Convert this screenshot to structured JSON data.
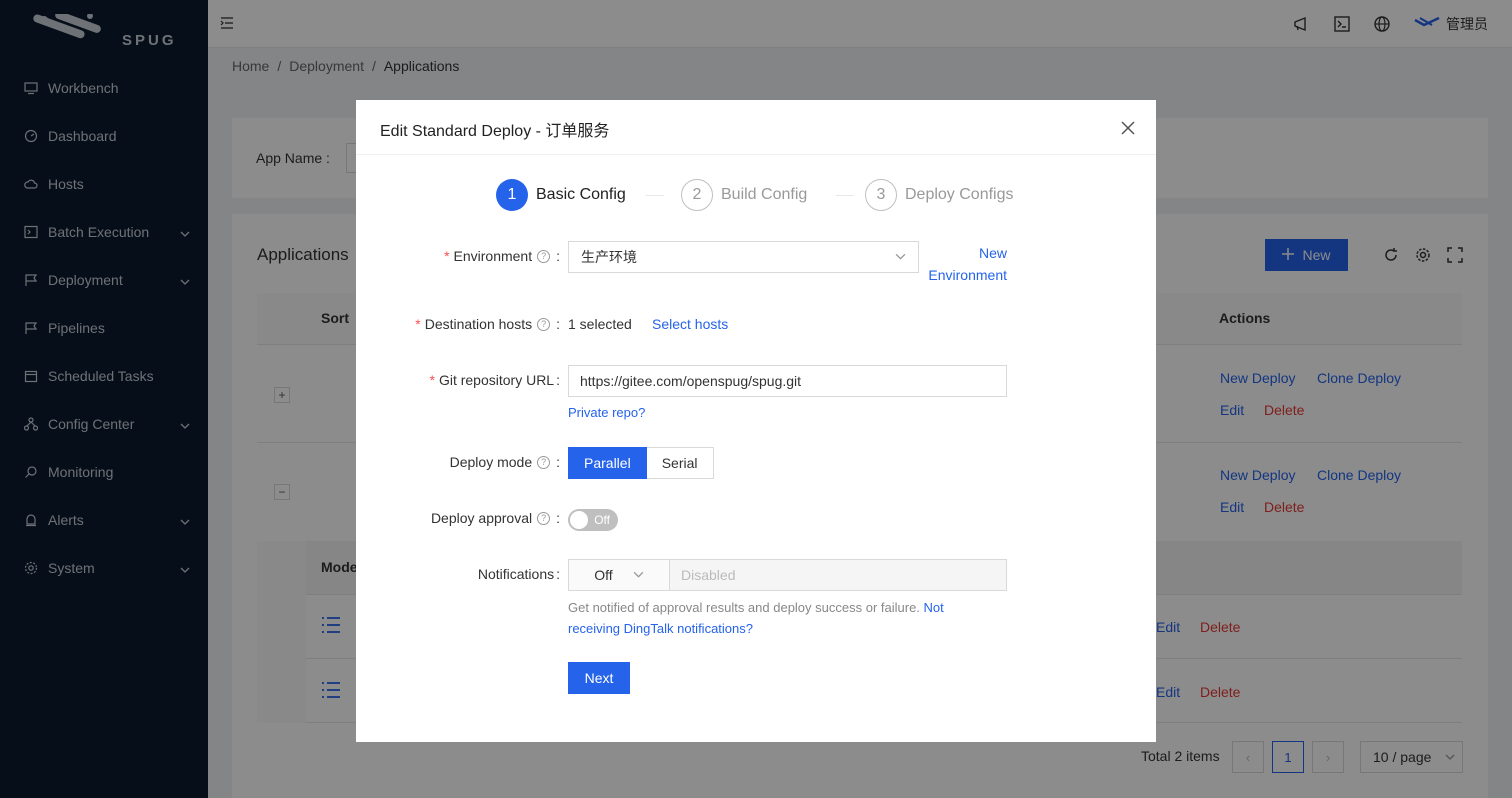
{
  "brand": {
    "name": "SPUG"
  },
  "sidebar": {
    "items": [
      {
        "label": "Workbench",
        "icon": "monitor-icon",
        "has_children": false
      },
      {
        "label": "Dashboard",
        "icon": "gauge-icon",
        "has_children": false
      },
      {
        "label": "Hosts",
        "icon": "cloud-icon",
        "has_children": false
      },
      {
        "label": "Batch Execution",
        "icon": "terminal-icon",
        "has_children": true
      },
      {
        "label": "Deployment",
        "icon": "flag-icon",
        "has_children": true
      },
      {
        "label": "Pipelines",
        "icon": "flag-icon",
        "has_children": false
      },
      {
        "label": "Scheduled Tasks",
        "icon": "calendar-icon",
        "has_children": false
      },
      {
        "label": "Config Center",
        "icon": "cluster-icon",
        "has_children": true
      },
      {
        "label": "Monitoring",
        "icon": "search-icon",
        "has_children": false
      },
      {
        "label": "Alerts",
        "icon": "bell-icon",
        "has_children": true
      },
      {
        "label": "System",
        "icon": "gear-icon",
        "has_children": true
      }
    ]
  },
  "header": {
    "user": "管理员"
  },
  "breadcrumb": {
    "home": "Home",
    "section": "Deployment",
    "current": "Applications"
  },
  "filter": {
    "app_name_label": "App Name :"
  },
  "table": {
    "title": "Applications",
    "new_label": "New",
    "col_sort": "Sort",
    "col_actions": "Actions",
    "row_actions": {
      "new_deploy": "New Deploy",
      "clone_deploy": "Clone Deploy",
      "edit": "Edit",
      "delete": "Delete"
    },
    "sub_col_mode": "Mode",
    "sub_edit": "Edit",
    "sub_delete": "Delete",
    "total": "Total 2 items",
    "page": "1",
    "page_size": "10 / page"
  },
  "modal": {
    "title": "Edit Standard Deploy - 订单服务",
    "steps": [
      {
        "num": "1",
        "label": "Basic Config"
      },
      {
        "num": "2",
        "label": "Build Config"
      },
      {
        "num": "3",
        "label": "Deploy Configs"
      }
    ],
    "environment": {
      "label": "Environment",
      "value": "生产环境",
      "new_line1": "New",
      "new_line2": "Environment"
    },
    "hosts": {
      "label": "Destination hosts",
      "count": "1 selected",
      "select_link": "Select hosts"
    },
    "git": {
      "label": "Git repository URL",
      "value": "https://gitee.com/openspug/spug.git",
      "private_link": "Private repo?"
    },
    "deploy_mode": {
      "label": "Deploy mode",
      "options": [
        "Parallel",
        "Serial"
      ],
      "selected": "Parallel"
    },
    "approval": {
      "label": "Deploy approval",
      "state": "Off"
    },
    "notifications": {
      "label": "Notifications",
      "value": "Off",
      "placeholder": "Disabled",
      "help": "Get notified of approval results and deploy success or failure.",
      "help_link": "Not receiving DingTalk notifications?"
    },
    "next_label": "Next"
  },
  "colors": {
    "primary": "#2563eb",
    "danger": "#e53935",
    "sidebar_bg": "#0b1a2e"
  }
}
